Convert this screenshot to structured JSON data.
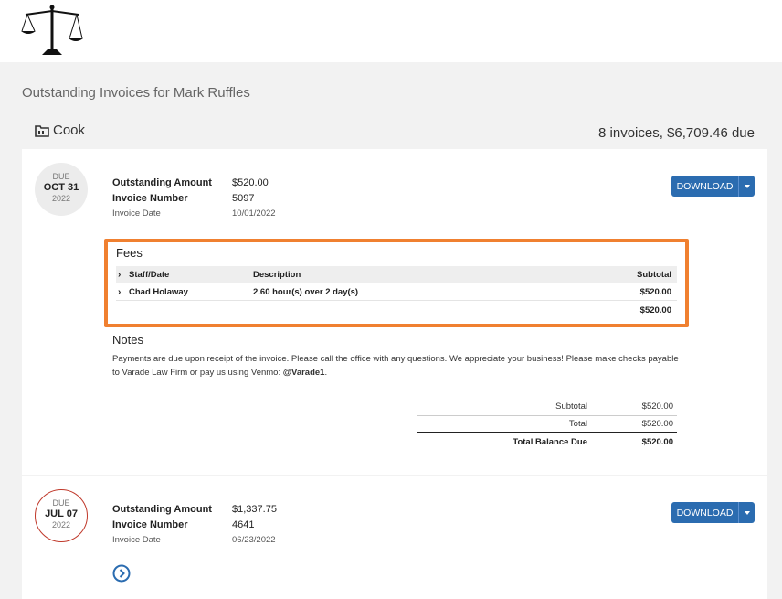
{
  "page": {
    "title": "Outstanding Invoices for Mark Ruffles",
    "matter": "Cook",
    "summary": "8 invoices, $6,709.46 due"
  },
  "icons": {
    "logo": "scales-of-justice-icon",
    "matter": "folder-icon",
    "expand": "chevron-right-circle-icon"
  },
  "colors": {
    "accent": "#2b6cb0",
    "highlight": "#f08030",
    "overdue": "#c0392b"
  },
  "invoices": [
    {
      "due_label": "DUE",
      "due_monthday": "OCT 31",
      "due_year": "2022",
      "outstanding_label": "Outstanding Amount",
      "outstanding_value": "$520.00",
      "number_label": "Invoice Number",
      "number_value": "5097",
      "date_label": "Invoice Date",
      "date_value": "10/01/2022",
      "download_label": "DOWNLOAD",
      "fees": {
        "title": "Fees",
        "headers": [
          "Staff/Date",
          "Description",
          "Subtotal"
        ],
        "rows": [
          {
            "staff": "Chad Holaway",
            "description": "2.60 hour(s) over 2 day(s)",
            "subtotal": "$520.00"
          }
        ],
        "total": "$520.00"
      },
      "notes": {
        "title": "Notes",
        "text_before": "Payments are due upon receipt of the invoice. Please call the office with any questions. We appreciate your business! Please make checks payable to Varade Law Firm or pay us using Venmo: ",
        "venmo": "@Varade1",
        "text_after": "."
      },
      "totals": [
        {
          "label": "Subtotal",
          "value": "$520.00"
        },
        {
          "label": "Total",
          "value": "$520.00"
        },
        {
          "label": "Total Balance Due",
          "value": "$520.00"
        }
      ]
    },
    {
      "due_label": "DUE",
      "due_monthday": "JUL 07",
      "due_year": "2022",
      "outstanding_label": "Outstanding Amount",
      "outstanding_value": "$1,337.75",
      "number_label": "Invoice Number",
      "number_value": "4641",
      "date_label": "Invoice Date",
      "date_value": "06/23/2022",
      "download_label": "DOWNLOAD"
    }
  ]
}
